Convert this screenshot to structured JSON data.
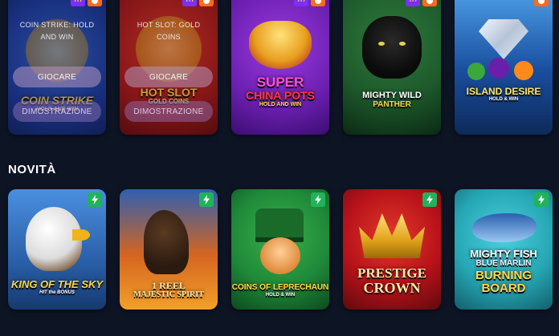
{
  "top_row": [
    {
      "overlay_title": "COIN STRIKE: HOLD AND WIN",
      "play_label": "GIOCARE",
      "demo_label": "DIMOSTRAZIONE",
      "art_title": "COIN STRIKE",
      "art_sub": "HOLD AND WIN",
      "badges": [
        "777",
        "hot"
      ],
      "bg": "#1b3fa8"
    },
    {
      "overlay_title": "HOT SLOT: GOLD COINS",
      "play_label": "GIOCARE",
      "demo_label": "DIMOSTRAZIONE",
      "art_title": "HOT SLOT",
      "art_sub": "GOLD COINS",
      "badges": [
        "777",
        "hot"
      ],
      "bg": "#a5161a"
    },
    {
      "art_title": "SUPER",
      "art_title2": "CHINA POTS",
      "art_sub": "HOLD AND WIN",
      "badges": [
        "777",
        "hot"
      ],
      "bg": "#6b1fb0"
    },
    {
      "art_title": "MIGHTY WILD",
      "art_sub": "PANTHER",
      "badges": [
        "777",
        "hot"
      ],
      "bg": "#1e5a2c"
    },
    {
      "art_title": "ISLAND DESIRE",
      "art_sub": "HOLD & WIN",
      "badges": [
        "hot"
      ],
      "bg": "#1a4fa0"
    }
  ],
  "section": {
    "title": "NOVITÀ"
  },
  "bottom_row": [
    {
      "art_title": "KING OF THE SKY",
      "art_sub": "HIT the BONUS",
      "bg": "#2a5fa8"
    },
    {
      "art_title": "1 REEL",
      "art_sub": "MAJESTIC SPIRIT",
      "bg": "#d5651f"
    },
    {
      "art_title": "COINS OF LEPRECHAUN",
      "art_sub": "HOLD & WIN",
      "bg": "#1f8a3a"
    },
    {
      "art_title": "PRESTIGE",
      "art_sub": "CROWN",
      "bg": "#b8121a"
    },
    {
      "art_title": "MIGHTY FISH",
      "art_title2": "BLUE MARLIN",
      "art_sub": "BURNING BOARD",
      "bg": "#27a7b5"
    }
  ],
  "colors": {
    "page_bg": "#0d1424",
    "badge_777": "#7b2ff7",
    "badge_hot": "#ff6a1c",
    "badge_new": "#21b35b"
  },
  "icons": {
    "hot_badge": "flame-icon",
    "new_badge": "lightning-icon",
    "777_badge": "sevens-icon"
  }
}
